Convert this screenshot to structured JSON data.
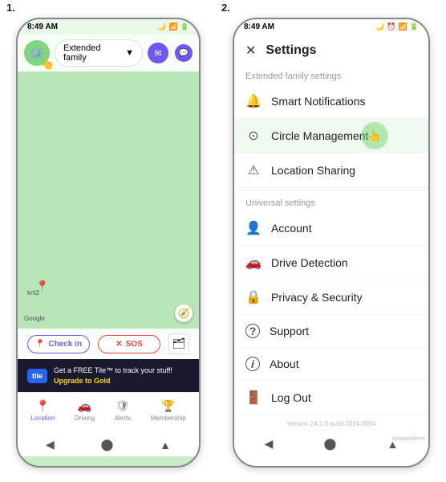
{
  "labels": {
    "screen1": "1.",
    "screen2": "2."
  },
  "screen1": {
    "statusBar": {
      "time": "8:49 AM",
      "batteryIcon": "🔋",
      "signalIcons": "📶"
    },
    "topbar": {
      "dropdown": "Extended family",
      "dropdownArrow": "▼"
    },
    "map": {
      "googleLabel": "Google",
      "pinLabel": "krit2"
    },
    "actions": {
      "checkin": "Check in",
      "checkinIcon": "📍",
      "sos": "SOS",
      "sosIcon": "✕"
    },
    "tilePromo": {
      "logo": "tile",
      "text": "Get a FREE Tile™ to track your stuff!",
      "upgrade": "Upgrade to Gold"
    },
    "bottomNav": [
      {
        "label": "Location",
        "icon": "📍"
      },
      {
        "label": "Driving",
        "icon": "🚗"
      },
      {
        "label": "Alerts",
        "icon": "🛡"
      },
      {
        "label": "Membership",
        "icon": "🏆"
      }
    ]
  },
  "screen2": {
    "statusBar": {
      "time": "8:49 AM"
    },
    "header": {
      "closeIcon": "✕",
      "title": "Settings"
    },
    "extendedFamilySection": "Extended family settings",
    "extendedFamilyItems": [
      {
        "icon": "🔔",
        "label": "Smart Notifications"
      },
      {
        "icon": "⊙",
        "label": "Circle Management"
      },
      {
        "icon": "⚠",
        "label": "Location Sharing"
      }
    ],
    "universalSection": "Universal settings",
    "universalItems": [
      {
        "icon": "👤",
        "label": "Account"
      },
      {
        "icon": "🚗",
        "label": "Drive Detection"
      },
      {
        "icon": "🔒",
        "label": "Privacy & Security"
      },
      {
        "icon": "?",
        "label": "Support"
      },
      {
        "icon": "ℹ",
        "label": "About"
      },
      {
        "icon": "→",
        "label": "Log Out"
      }
    ],
    "version": "Version 24.1.0 build 2824.0004"
  }
}
